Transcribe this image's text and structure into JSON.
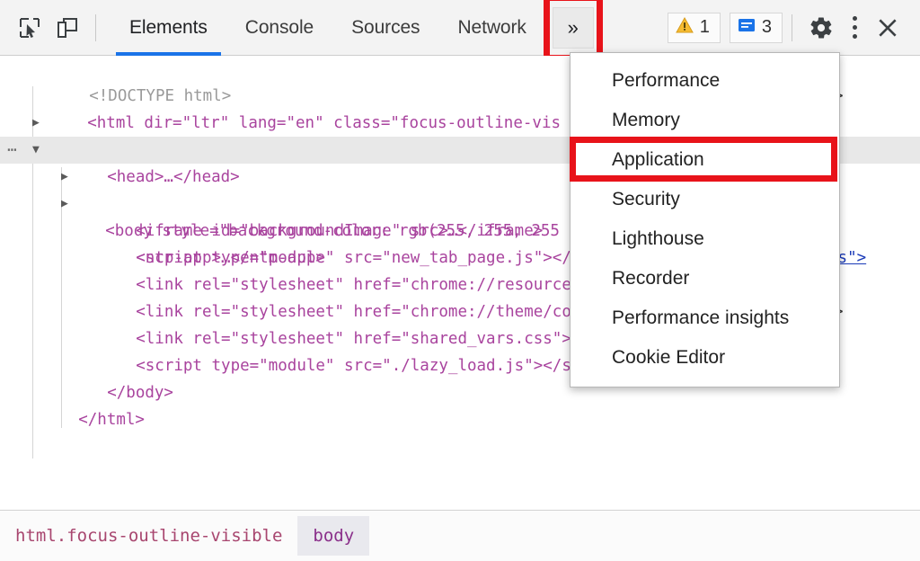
{
  "toolbar": {
    "inspect_icon": "inspect-element-icon",
    "device_icon": "device-toolbar-icon",
    "tabs": [
      {
        "label": "Elements",
        "active": true
      },
      {
        "label": "Console",
        "active": false
      },
      {
        "label": "Sources",
        "active": false
      },
      {
        "label": "Network",
        "active": false
      }
    ],
    "more_tabs_label": "»",
    "warning_count": "1",
    "message_count": "3",
    "warning_icon": "warning-triangle-icon",
    "message_icon": "message-box-icon",
    "settings_icon": "gear-icon",
    "kebab_icon": "more-options-icon",
    "close_icon": "close-icon"
  },
  "menu": {
    "items": [
      {
        "label": "Performance"
      },
      {
        "label": "Memory"
      },
      {
        "label": "Application"
      },
      {
        "label": "Security"
      },
      {
        "label": "Lighthouse"
      },
      {
        "label": "Recorder"
      },
      {
        "label": "Performance insights"
      },
      {
        "label": "Cookie Editor"
      }
    ],
    "highlighted": "Application"
  },
  "dom": {
    "lines": [
      {
        "id": "doctype",
        "text": "<!DOCTYPE html>"
      },
      {
        "id": "html-open",
        "text": "<html dir=\"ltr\" lang=\"en\" class=\"focus-outline-vis"
      },
      {
        "id": "head",
        "text": "<head>…</head>"
      },
      {
        "id": "body-open",
        "text": "<body style=\"background-color: rgb(255, 255, 255"
      },
      {
        "id": "iframe",
        "text": "<iframe id=\"backgroundImage\" src>…</iframe>"
      },
      {
        "id": "ntp-app",
        "text": "<ntp-app>…</ntp-app>"
      },
      {
        "id": "script-newtab",
        "text": "<script type=\"module\" src=\"new_tab_page.js\"></"
      },
      {
        "id": "link-resource",
        "text": "<link rel=\"stylesheet\" href=\"chrome://resource"
      },
      {
        "id": "link-theme",
        "text": "<link rel=\"stylesheet\" href=\"chrome://theme/co"
      },
      {
        "id": "link-shared",
        "text": "<link rel=\"stylesheet\" href=\"shared_vars.css\">"
      },
      {
        "id": "script-lazy",
        "text": "<script type=\"module\" src=\"./lazy_load.js\"></s"
      },
      {
        "id": "body-close",
        "text": "</body>"
      },
      {
        "id": "html-close",
        "text": "</html>"
      }
    ],
    "clipped_right": {
      "html_open_tail": ">",
      "link_resource_tail": "ss\">",
      "link_theme_tail": ">"
    },
    "selected_line": "body-open",
    "badge_dots": "⋯"
  },
  "breadcrumb": {
    "items": [
      {
        "label": "html.focus-outline-visible",
        "selected": false
      },
      {
        "label": "body",
        "selected": true
      }
    ]
  },
  "colors": {
    "accent_blue": "#1a73e8",
    "highlight_red": "#e8131a",
    "tag_purple": "#a9449e",
    "attr_orange": "#a8742b",
    "value_blue": "#1a1aa6",
    "selection_gray": "#e8e8e8"
  }
}
